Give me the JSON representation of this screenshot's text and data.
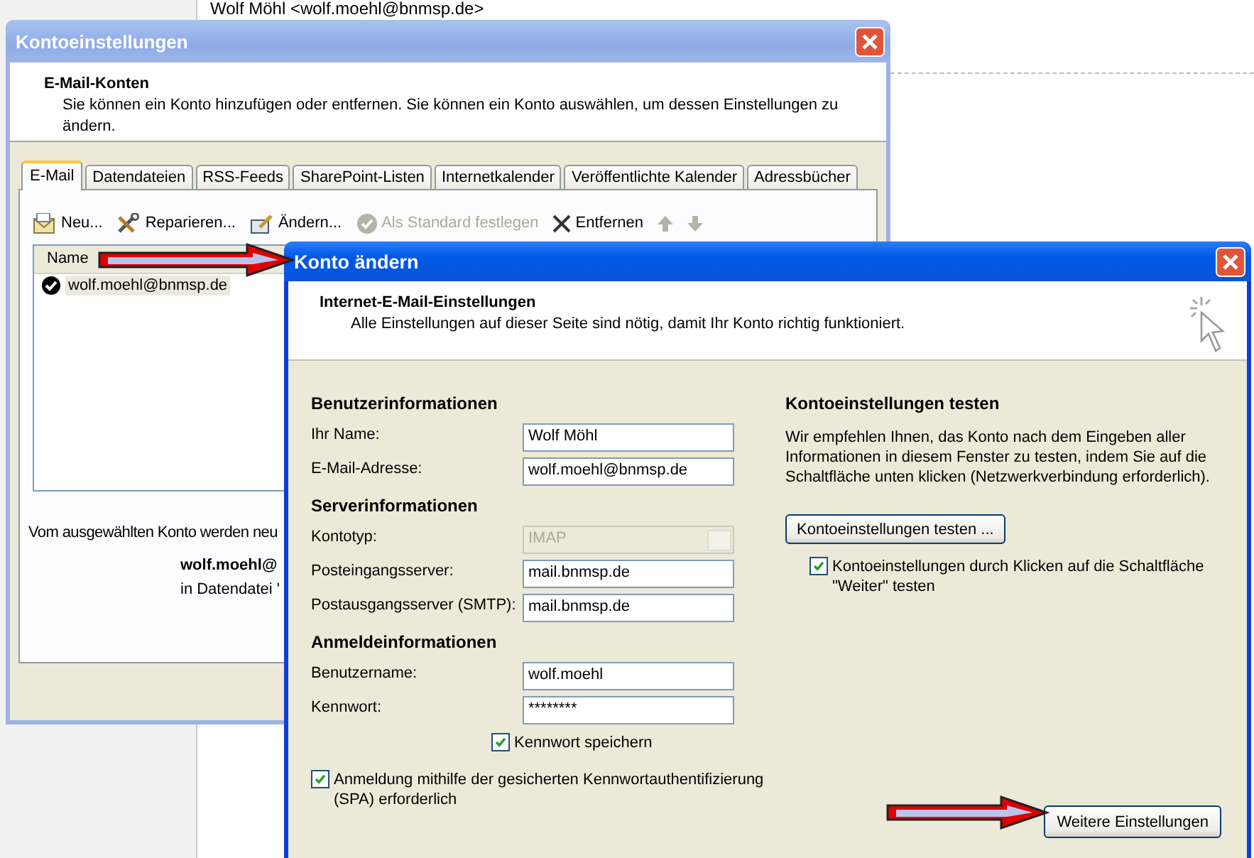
{
  "background": {
    "sender": "Wolf Möhl <wolf.moehl@bnmsp.de>"
  },
  "account_settings": {
    "title": "Kontoeinstellungen",
    "heading": "E-Mail-Konten",
    "description": "Sie können ein Konto hinzufügen oder entfernen. Sie können ein Konto auswählen, um dessen Einstellungen zu ändern.",
    "tabs": [
      {
        "label": "E-Mail",
        "selected": true
      },
      {
        "label": "Datendateien",
        "selected": false
      },
      {
        "label": "RSS-Feeds",
        "selected": false
      },
      {
        "label": "SharePoint-Listen",
        "selected": false
      },
      {
        "label": "Internetkalender",
        "selected": false
      },
      {
        "label": "Veröffentlichte Kalender",
        "selected": false
      },
      {
        "label": "Adressbücher",
        "selected": false
      }
    ],
    "toolbar": [
      {
        "kind": "new",
        "label": "Neu...",
        "disabled": false
      },
      {
        "kind": "repair",
        "label": "Reparieren...",
        "disabled": false
      },
      {
        "kind": "change",
        "label": "Ändern...",
        "disabled": false
      },
      {
        "kind": "default",
        "label": "Als Standard festlegen",
        "disabled": true
      },
      {
        "kind": "remove",
        "label": "Entfernen",
        "disabled": false
      },
      {
        "kind": "up",
        "disabled": true
      },
      {
        "kind": "down",
        "disabled": true
      }
    ],
    "list": {
      "column": "Name",
      "items": [
        {
          "address": "wolf.moehl@bnmsp.de",
          "selected": true,
          "default": true
        }
      ]
    },
    "footer_note": "Vom ausgewählten Konto werden neu",
    "footer_account": "wolf.moehl@",
    "footer_file": "in Datendatei '"
  },
  "change_account": {
    "title": "Konto ändern",
    "heading": "Internet-E-Mail-Einstellungen",
    "description": "Alle Einstellungen auf dieser Seite sind nötig, damit Ihr Konto richtig funktioniert.",
    "sections": [
      {
        "heading": "Benutzerinformationen",
        "fields": [
          {
            "kind": "text",
            "label": "Ihr Name:",
            "value": "Wolf Möhl",
            "disabled": false
          },
          {
            "kind": "text",
            "label": "E-Mail-Adresse:",
            "value": "wolf.moehl@bnmsp.de",
            "disabled": false
          }
        ]
      },
      {
        "heading": "Serverinformationen",
        "fields": [
          {
            "kind": "select",
            "label": "Kontotyp:",
            "value": "IMAP",
            "disabled": true
          },
          {
            "kind": "text",
            "label": "Posteingangsserver:",
            "value": "mail.bnmsp.de",
            "disabled": false
          },
          {
            "kind": "text",
            "label": "Postausgangsserver (SMTP):",
            "value": "mail.bnmsp.de",
            "disabled": false
          }
        ]
      },
      {
        "heading": "Anmeldeinformationen",
        "fields": [
          {
            "kind": "text",
            "label": "Benutzername:",
            "value": "wolf.moehl",
            "disabled": false
          },
          {
            "kind": "password",
            "label": "Kennwort:",
            "value": "********",
            "disabled": false
          }
        ]
      }
    ],
    "remember_password": {
      "label": "Kennwort speichern",
      "checked": true
    },
    "spa": {
      "label": "Anmeldung mithilfe der gesicherten Kennwortauthentifizierung (SPA) erforderlich",
      "checked": true
    },
    "test": {
      "heading": "Kontoeinstellungen testen",
      "text": "Wir empfehlen Ihnen, das Konto nach dem Eingeben aller Informationen in diesem Fenster zu testen, indem Sie auf die Schaltfläche unten klicken (Netzwerkverbindung erforderlich).",
      "button": "Kontoeinstellungen testen ...",
      "checkbox": {
        "label": "Kontoeinstellungen durch Klicken auf die Schaltfläche \"Weiter\" testen",
        "checked": true
      }
    },
    "more_button": "Weitere Einstellungen"
  }
}
